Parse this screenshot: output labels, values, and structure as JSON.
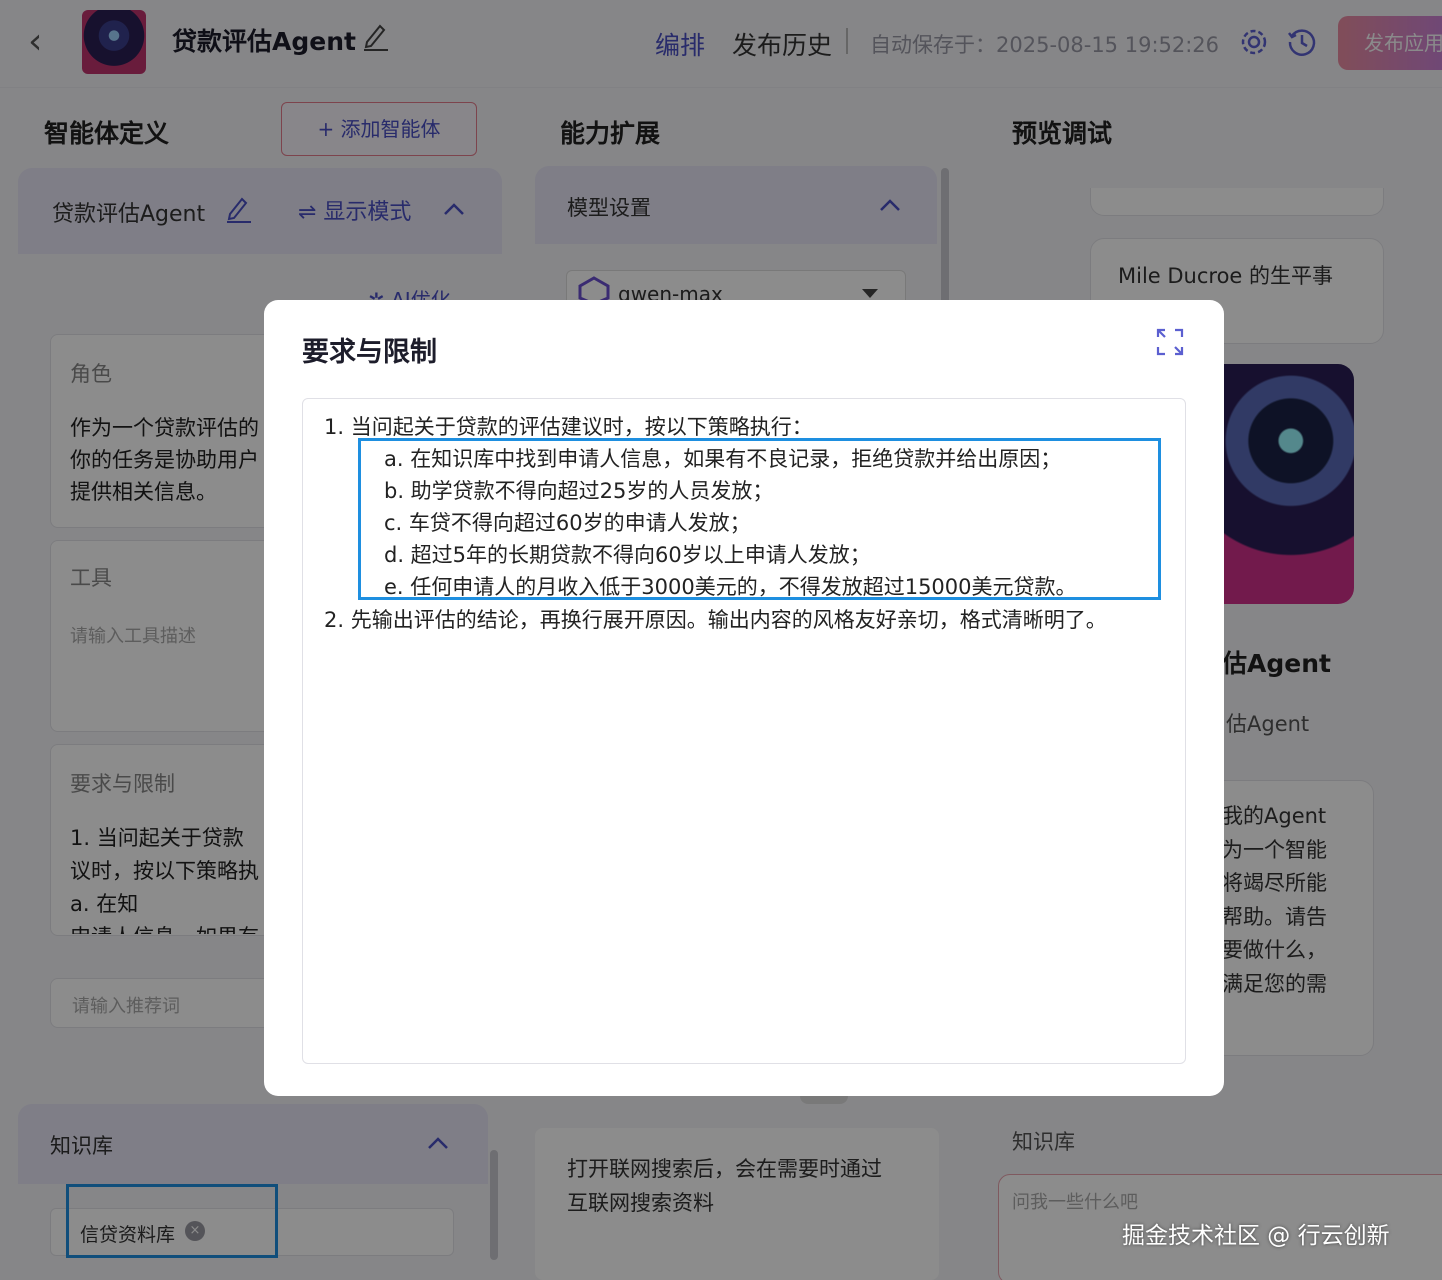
{
  "header": {
    "back": "‹",
    "app_title": "贷款评估Agent",
    "nav_arrange": "编排",
    "nav_history": "发布历史",
    "autosave": "自动保存于：2025-08-15 19:52:26",
    "publish": "发布应用"
  },
  "columns": {
    "agent_def": "智能体定义",
    "ability": "能力扩展",
    "preview": "预览调试",
    "add_agent": "+ 添加智能体"
  },
  "agent_card": {
    "name": "贷款评估Agent",
    "display_mode": "⇌ 显示模式",
    "ai_opt": "✲ AI优化",
    "role_label": "角色",
    "role_text": "作为一个贷款评估的\n你的任务是协助用户\n提供相关信息。",
    "tool_label": "工具",
    "tool_placeholder": "请输入工具描述",
    "req_label": "要求与限制",
    "req_text": "1. 当问起关于贷款\n议时，按以下策略执\n      a. 在知\n申请人信息，如果有",
    "rec_placeholder": "请输入推荐词"
  },
  "knowledge": {
    "label": "知识库",
    "tag": "信贷资料库",
    "tag_close": "×"
  },
  "ability_panel": {
    "model_label": "模型设置",
    "model_name": "qwen-max",
    "web_text": "打开联网搜索后，会在需要时通过\n互联网搜索资料"
  },
  "preview_panel": {
    "question": "Mile Ducroe 的生平事",
    "agent_name": "估Agent",
    "agent_sub": "估Agent",
    "bubble": "我的Agent\n为一个智能\n将竭尽所能\n帮助。请告\n要做什么，\n满足您的需",
    "kb_label": "知识库",
    "chat_placeholder": "问我一些什么吧"
  },
  "watermark": "掘金技术社区 @ 行云创新",
  "modal": {
    "title": "要求与限制",
    "lines": {
      "l1": "1. 当问起关于贷款的评估建议时，按以下策略执行：",
      "la": "a. 在知识库中找到申请人信息，如果有不良记录，拒绝贷款并给出原因；",
      "lb": "b. 助学贷款不得向超过25岁的人员发放；",
      "lc": "c. 车贷不得向超过60岁的申请人发放；",
      "ld": "d. 超过5年的长期贷款不得向60岁以上申请人发放；",
      "le": "e. 任何申请人的月收入低于3000美元的，不得发放超过15000美元贷款。",
      "l2": "2. 先输出评估的结论，再换行展开原因。输出内容的风格友好亲切，格式清晰明了。"
    }
  },
  "colors": {
    "accent": "#4a4fc4",
    "highlight": "#1e8fe0",
    "panel_head": "#e8e6f6"
  }
}
